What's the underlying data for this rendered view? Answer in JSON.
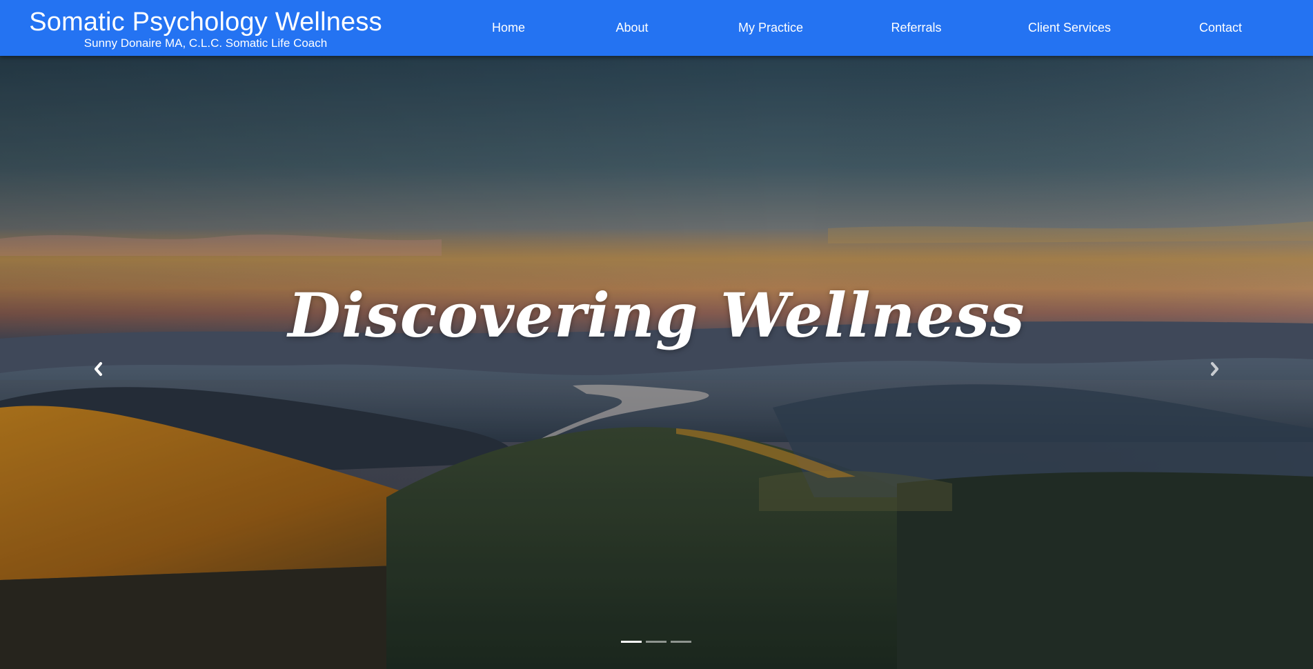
{
  "brand": {
    "title": "Somatic Psychology Wellness",
    "subtitle": "Sunny Donaire MA, C.L.C. Somatic Life Coach"
  },
  "nav": {
    "items": [
      {
        "label": "Home"
      },
      {
        "label": "About"
      },
      {
        "label": "My Practice"
      },
      {
        "label": "Referrals"
      },
      {
        "label": "Client Services"
      },
      {
        "label": "Contact"
      }
    ]
  },
  "hero": {
    "heading": "Discovering Wellness",
    "prev_icon": "chevron-left-icon",
    "next_icon": "chevron-right-icon",
    "slide_count": 3,
    "active_slide": 1
  },
  "colors": {
    "navbar": "#2473f2",
    "text": "#ffffff"
  }
}
